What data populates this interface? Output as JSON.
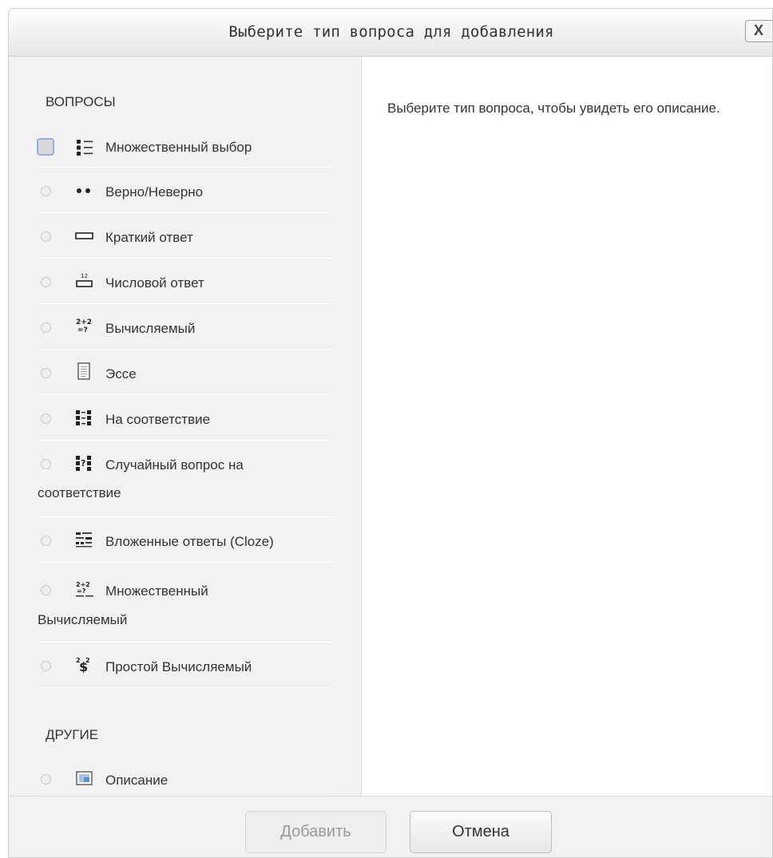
{
  "dialog": {
    "title": "Выберите тип вопроса для добавления",
    "close_label": "X"
  },
  "sections": {
    "questions_heading": "ВОПРОСЫ",
    "other_heading": "ДРУГИЕ"
  },
  "question_types": [
    {
      "label": "Множественный выбор",
      "icon": "multichoice-icon"
    },
    {
      "label": "Верно/Неверно",
      "icon": "truefalse-icon"
    },
    {
      "label": "Краткий ответ",
      "icon": "shortanswer-icon"
    },
    {
      "label": "Числовой ответ",
      "icon": "numerical-icon"
    },
    {
      "label": "Вычисляемый",
      "icon": "calculated-icon"
    },
    {
      "label": "Эссе",
      "icon": "essay-icon"
    },
    {
      "label": "На соответствие",
      "icon": "match-icon"
    },
    {
      "label_line1": "Случайный вопрос на",
      "label_line2": "соответствие",
      "icon": "randomsamatch-icon"
    },
    {
      "label": "Вложенные ответы (Cloze)",
      "icon": "cloze-icon"
    },
    {
      "label_line1": "Множественный",
      "label_line2": "Вычисляемый",
      "icon": "calculatedmulti-icon"
    },
    {
      "label": "Простой Вычисляемый",
      "icon": "calculatedsimple-icon"
    }
  ],
  "other_types": [
    {
      "label": "Описание",
      "icon": "description-icon"
    }
  ],
  "description_panel": {
    "text": "Выберите тип вопроса, чтобы увидеть его описание."
  },
  "footer": {
    "add_label": "Добавить",
    "cancel_label": "Отмена"
  }
}
